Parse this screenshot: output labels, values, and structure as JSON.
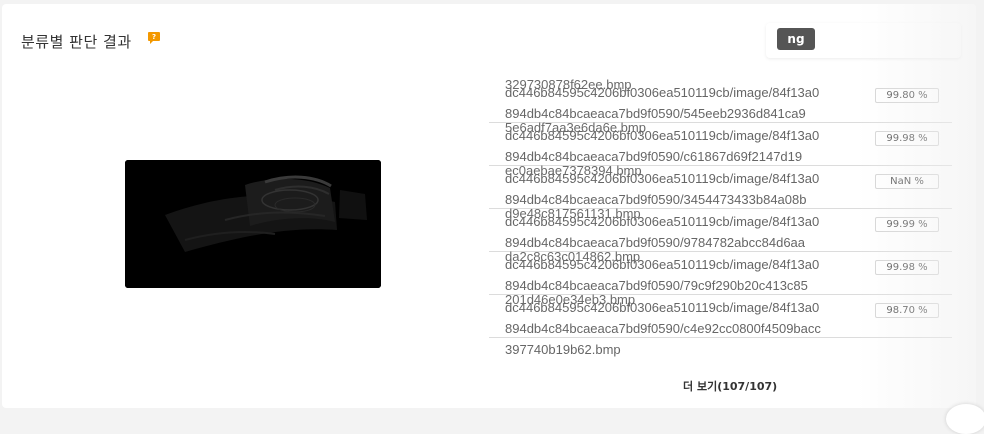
{
  "card": {
    "title": "분류별 판단 결과",
    "help_icon_color": "#f39800",
    "help_icon_glyph": "?"
  },
  "tag": {
    "label": "ng"
  },
  "preview": {
    "background": "#000000"
  },
  "files": [
    {
      "overlap": "329730878f62ee.bmp",
      "name": "dc446b84595c4206bf0306ea510119cb/image/84f13a0894db4c84bcaeaca7bd9f0590/545eeb2936d841ca9",
      "score": "99.80 %"
    },
    {
      "overlap": "5e6adf7aa3e6da6e.bmp",
      "name": "dc446b84595c4206bf0306ea510119cb/image/84f13a0894db4c84bcaeaca7bd9f0590/c61867d69f2147d19",
      "score": "99.98 %"
    },
    {
      "overlap": "ec0aebae7378394.bmp",
      "name": "dc446b84595c4206bf0306ea510119cb/image/84f13a0894db4c84bcaeaca7bd9f0590/3454473433b84a08b",
      "score": "NaN %"
    },
    {
      "overlap": "d9e48c817561131.bmp",
      "name": "dc446b84595c4206bf0306ea510119cb/image/84f13a0894db4c84bcaeaca7bd9f0590/9784782abcc84d6aa",
      "score": "99.99 %"
    },
    {
      "overlap": "da2c8c63c014862.bmp",
      "name": "dc446b84595c4206bf0306ea510119cb/image/84f13a0894db4c84bcaeaca7bd9f0590/79c9f290b20c413c85",
      "score": "99.98 %"
    },
    {
      "overlap": "201d46e0e34eb3.bmp",
      "name": "dc446b84595c4206bf0306ea510119cb/image/84f13a0894db4c84bcaeaca7bd9f0590/c4e92cc0800f4509bacc397740b19b62.bmp",
      "score": "98.70 %"
    }
  ],
  "more": {
    "label": "더 보기(107/107)"
  }
}
